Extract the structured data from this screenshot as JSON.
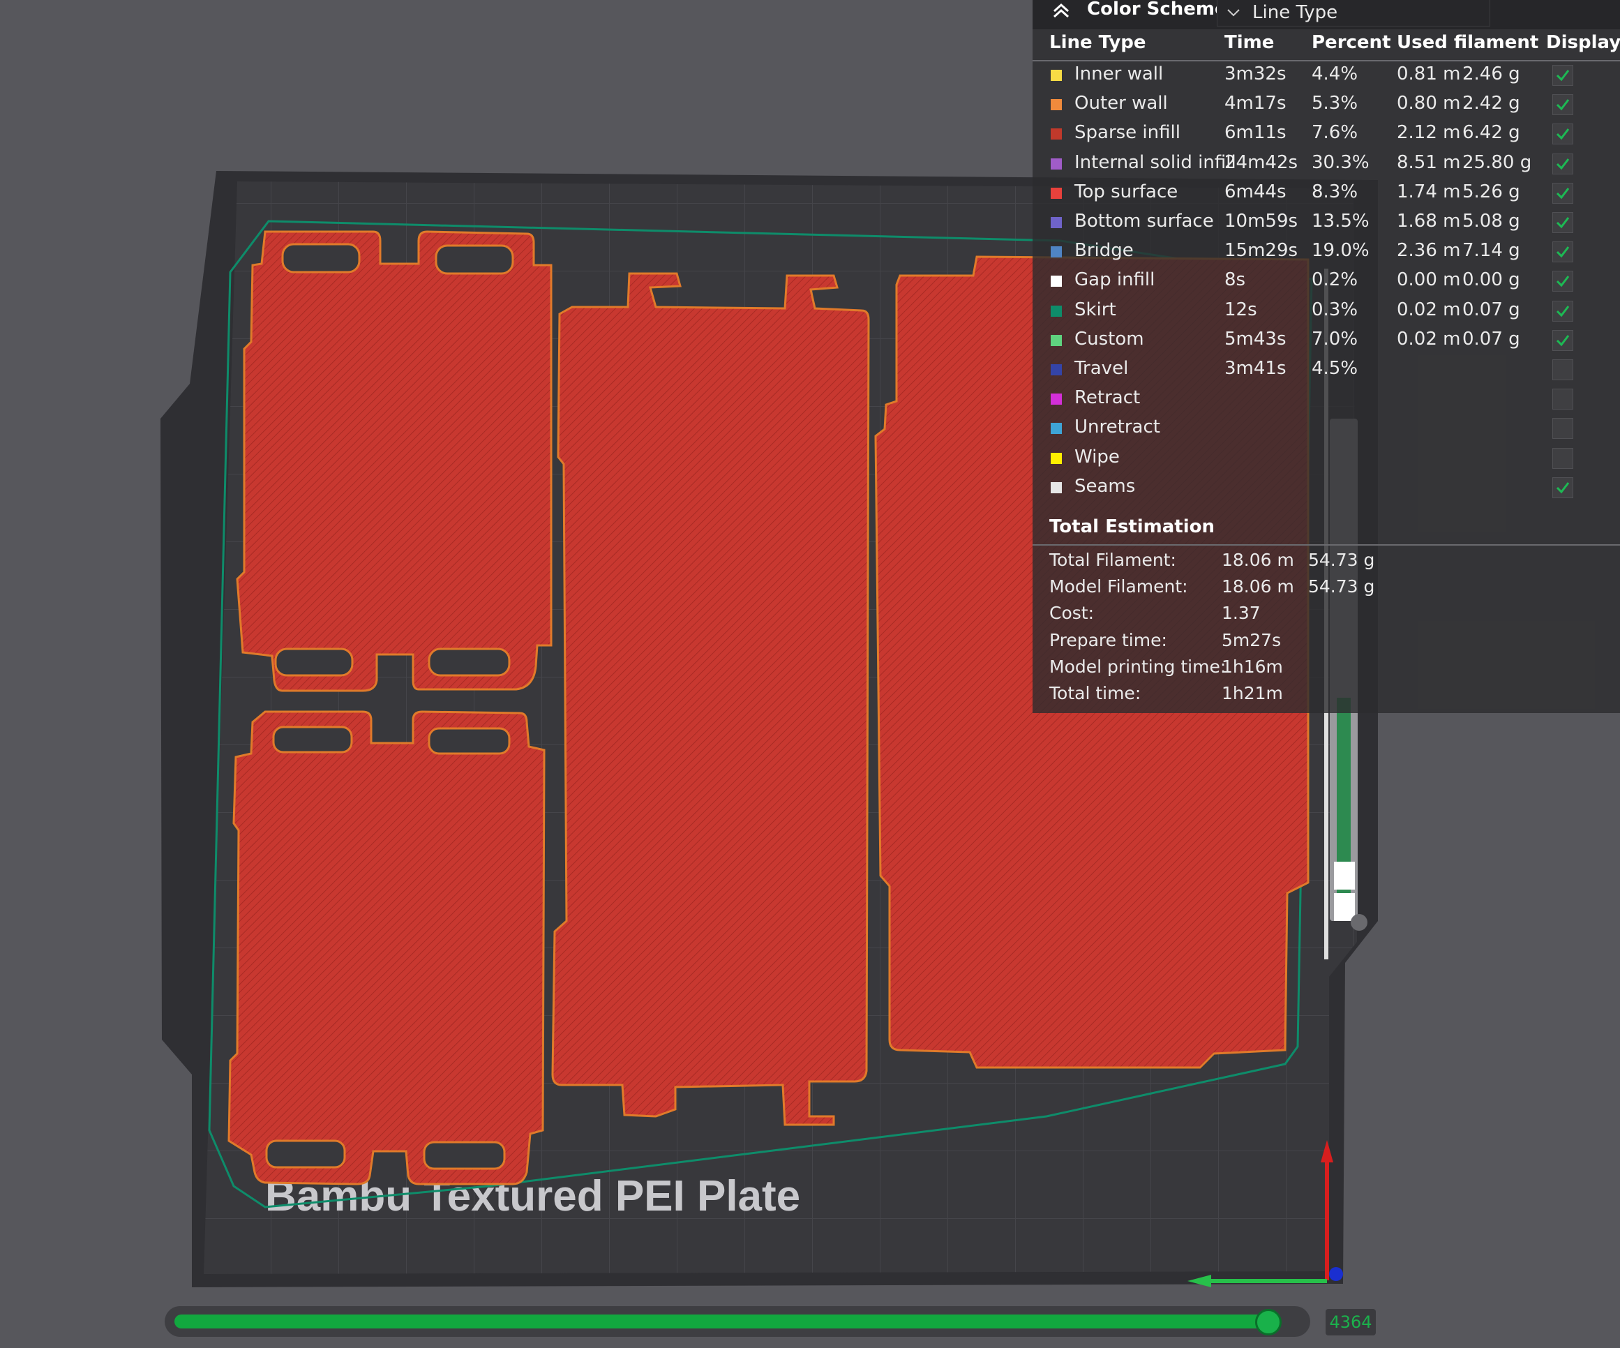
{
  "color_scheme": {
    "title": "Color Scheme",
    "selected": "Line Type"
  },
  "table": {
    "headers": {
      "line_type": "Line Type",
      "time": "Time",
      "percent": "Percent",
      "used_filament": "Used filament",
      "display": "Display"
    },
    "rows": [
      {
        "name": "Inner wall",
        "color": "#f7dc45",
        "time": "3m32s",
        "percent": "4.4%",
        "length": "0.81 m",
        "weight": "2.46 g",
        "display": true
      },
      {
        "name": "Outer wall",
        "color": "#f08a3c",
        "time": "4m17s",
        "percent": "5.3%",
        "length": "0.80 m",
        "weight": "2.42 g",
        "display": true
      },
      {
        "name": "Sparse infill",
        "color": "#c0392b",
        "time": "6m11s",
        "percent": "7.6%",
        "length": "2.12 m",
        "weight": "6.42 g",
        "display": true
      },
      {
        "name": "Internal solid infill",
        "color": "#a05cc8",
        "time": "24m42s",
        "percent": "30.3%",
        "length": "8.51 m",
        "weight": "25.80 g",
        "display": true
      },
      {
        "name": "Top surface",
        "color": "#e8413c",
        "time": "6m44s",
        "percent": "8.3%",
        "length": "1.74 m",
        "weight": "5.26 g",
        "display": true
      },
      {
        "name": "Bottom surface",
        "color": "#6f63c9",
        "time": "10m59s",
        "percent": "13.5%",
        "length": "1.68 m",
        "weight": "5.08 g",
        "display": true
      },
      {
        "name": "Bridge",
        "color": "#4f84c4",
        "time": "15m29s",
        "percent": "19.0%",
        "length": "2.36 m",
        "weight": "7.14 g",
        "display": true
      },
      {
        "name": "Gap infill",
        "color": "#ffffff",
        "time": "8s",
        "percent": "0.2%",
        "length": "0.00 m",
        "weight": "0.00 g",
        "display": true
      },
      {
        "name": "Skirt",
        "color": "#0e8c6a",
        "time": "12s",
        "percent": "0.3%",
        "length": "0.02 m",
        "weight": "0.07 g",
        "display": true
      },
      {
        "name": "Custom",
        "color": "#5fd37f",
        "time": "5m43s",
        "percent": "7.0%",
        "length": "0.02 m",
        "weight": "0.07 g",
        "display": true
      },
      {
        "name": "Travel",
        "color": "#3444a8",
        "time": "3m41s",
        "percent": "4.5%",
        "length": "",
        "weight": "",
        "display": false
      },
      {
        "name": "Retract",
        "color": "#d42fd8",
        "time": "",
        "percent": "",
        "length": "",
        "weight": "",
        "display": false
      },
      {
        "name": "Unretract",
        "color": "#3ea4d6",
        "time": "",
        "percent": "",
        "length": "",
        "weight": "",
        "display": false
      },
      {
        "name": "Wipe",
        "color": "#ffef00",
        "time": "",
        "percent": "",
        "length": "",
        "weight": "",
        "display": false
      },
      {
        "name": "Seams",
        "color": "#e6e6e6",
        "time": "",
        "percent": "",
        "length": "",
        "weight": "",
        "display": true
      }
    ]
  },
  "total": {
    "title": "Total Estimation",
    "rows": [
      {
        "label": "Total Filament:",
        "v1": "18.06 m",
        "v2": "54.73 g"
      },
      {
        "label": "Model Filament:",
        "v1": "18.06 m",
        "v2": "54.73 g"
      },
      {
        "label": "Cost:",
        "v1": "1.37",
        "v2": ""
      },
      {
        "label": "Prepare time:",
        "v1": "5m27s",
        "v2": ""
      },
      {
        "label": "Model printing time:",
        "v1": "1h16m",
        "v2": ""
      },
      {
        "label": "Total time:",
        "v1": "1h21m",
        "v2": ""
      }
    ]
  },
  "plate": {
    "label": "Bambu Textured PEI Plate",
    "part_color": "#c93a30",
    "outline_color": "#e07a2a",
    "skirt_color": "#0e8c6a"
  },
  "layer_slider": {
    "value": "4364",
    "fill_fraction": 0.995
  },
  "axes": {
    "x_color": "#27c04a",
    "z_color": "#d81e1e",
    "y_color": "#1a2fd0"
  }
}
